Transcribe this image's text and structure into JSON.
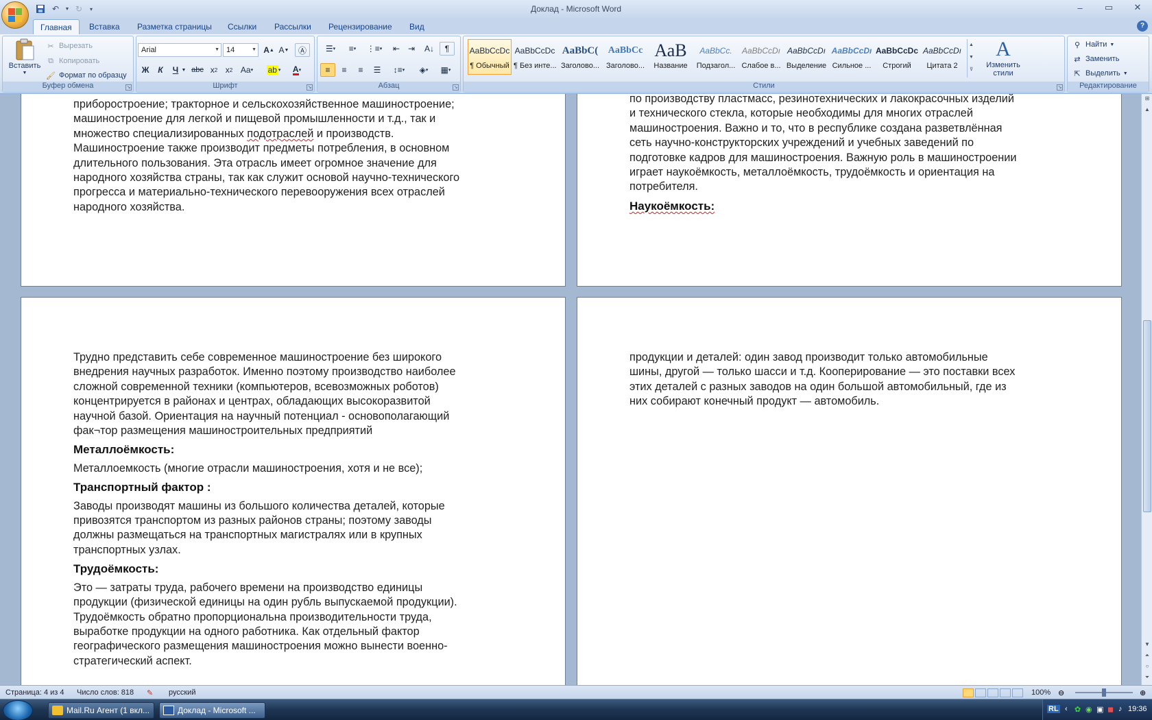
{
  "window": {
    "title": "Доклад - Microsoft Word"
  },
  "tabs": [
    {
      "label": "Главная"
    },
    {
      "label": "Вставка"
    },
    {
      "label": "Разметка страницы"
    },
    {
      "label": "Ссылки"
    },
    {
      "label": "Рассылки"
    },
    {
      "label": "Рецензирование"
    },
    {
      "label": "Вид"
    }
  ],
  "ribbon": {
    "clipboard": {
      "label": "Буфер обмена",
      "paste": "Вставить",
      "cut": "Вырезать",
      "copy": "Копировать",
      "format_painter": "Формат по образцу"
    },
    "font": {
      "label": "Шрифт",
      "font_name": "Arial",
      "font_size": "14"
    },
    "paragraph": {
      "label": "Абзац"
    },
    "styles": {
      "label": "Стили",
      "items": [
        {
          "sample": "AaBbCcDc",
          "name": "¶ Обычный"
        },
        {
          "sample": "AaBbCcDc",
          "name": "¶ Без инте..."
        },
        {
          "sample": "AaBbC(",
          "name": "Заголово..."
        },
        {
          "sample": "AaBbCc",
          "name": "Заголово..."
        },
        {
          "sample": "АаВ",
          "name": "Название"
        },
        {
          "sample": "AaBbCc.",
          "name": "Подзагол..."
        },
        {
          "sample": "AaBbCcDı",
          "name": "Слабое в..."
        },
        {
          "sample": "AaBbCcDı",
          "name": "Выделение"
        },
        {
          "sample": "AaBbCcDı",
          "name": "Сильное ..."
        },
        {
          "sample": "AaBbCcDc",
          "name": "Строгий"
        },
        {
          "sample": "AaBbCcDı",
          "name": "Цитата 2"
        }
      ],
      "change_styles": "Изменить стили"
    },
    "editing": {
      "label": "Редактирование",
      "find": "Найти",
      "replace": "Заменить",
      "select": "Выделить"
    }
  },
  "document": {
    "page1": {
      "lines": [
        "приборостроение; тракторное и сельскохозяйственное машиностроение;",
        "машиностроение для легкой и  пищевой промышленности и т.д., так и",
        "множество специализированных подотраслей и производств.",
        "Машиностроение также производит предметы потребления, в основном",
        "длительного пользования. Эта отрасль имеет огромное значение для",
        "народного хозяйства страны, так как служит основой научно-технического",
        "прогресса и материально-технического перевооружения всех отраслей",
        "народного хозяйства."
      ]
    },
    "page2": {
      "lines": [
        "по производству пластмасс, резинотехнических и лакокрасочных изделий",
        "и технического стекла, которые необходимы для многих отраслей",
        "машиностроения. Важно и то, что в республике создана разветвлённая",
        "сеть научно-конструкторских учреждений и учебных заведений по",
        "подготовке кадров для машиностроения. Важную роль в машиностроении",
        "играет  наукоёмкость, металлоёмкость, трудоёмкость и ориентация на",
        "потребителя."
      ],
      "heading": "Наукоёмкость:"
    },
    "page3": {
      "intro_lines": [
        "Трудно представить себе современное машиностроение без широкого",
        "внедрения научных разработок. Именно поэтому производство наиболее",
        "сложной современной техники (компьютеров, всевозможных роботов)",
        "концентрируется в районах и центрах, обладающих высокоразвитой",
        "научной базой. Ориентация на научный потенциал - основополагающий",
        "фак¬тор размещения машиностроительных предприятий"
      ],
      "heading_metal": "Металлоёмкость:",
      "metal_text": "Металлоемкость (многие отрасли машиностроения, хотя и не все);",
      "heading_transport": "Транспортный фактор :",
      "transport_lines": [
        "Заводы производят машины из большого количества деталей, которые",
        "привозятся транспортом из разных районов страны; поэтому заводы",
        "должны размещаться на транспортных магистралях или в крупных",
        "транспортных узлах."
      ],
      "heading_labor": "Трудоёмкость:",
      "labor_lines": [
        "Это — затраты труда, рабочего времени на производство единицы",
        "продукции (физической единицы на один рубль выпускаемой продукции).",
        "Трудоёмкость обратно пропорциональна производительности труда,",
        "выработке продукции на одного работника. Как отдельный фактор",
        "географического размещения машиностроения можно вынести военно-",
        "стратегический аспект."
      ]
    },
    "page4": {
      "lines": [
        "продукции и деталей: один завод производит только автомобильные",
        "шины, другой — только шасси и т.д.   Кооперирование — это поставки всех",
        "этих деталей с разных заводов на один большой автомобильный, где из",
        "них собирают конечный продукт — автомобиль."
      ]
    }
  },
  "statusbar": {
    "page": "Страница: 4 из 4",
    "words": "Число слов: 818",
    "language": "русский",
    "zoom": "100%",
    "zoom_level": 0.5
  },
  "taskbar": {
    "items": [
      {
        "label": "Mail.Ru Агент (1 вкл..."
      },
      {
        "label": "Доклад - Microsoft ..."
      }
    ],
    "lang": "RL",
    "time": "19:36"
  }
}
